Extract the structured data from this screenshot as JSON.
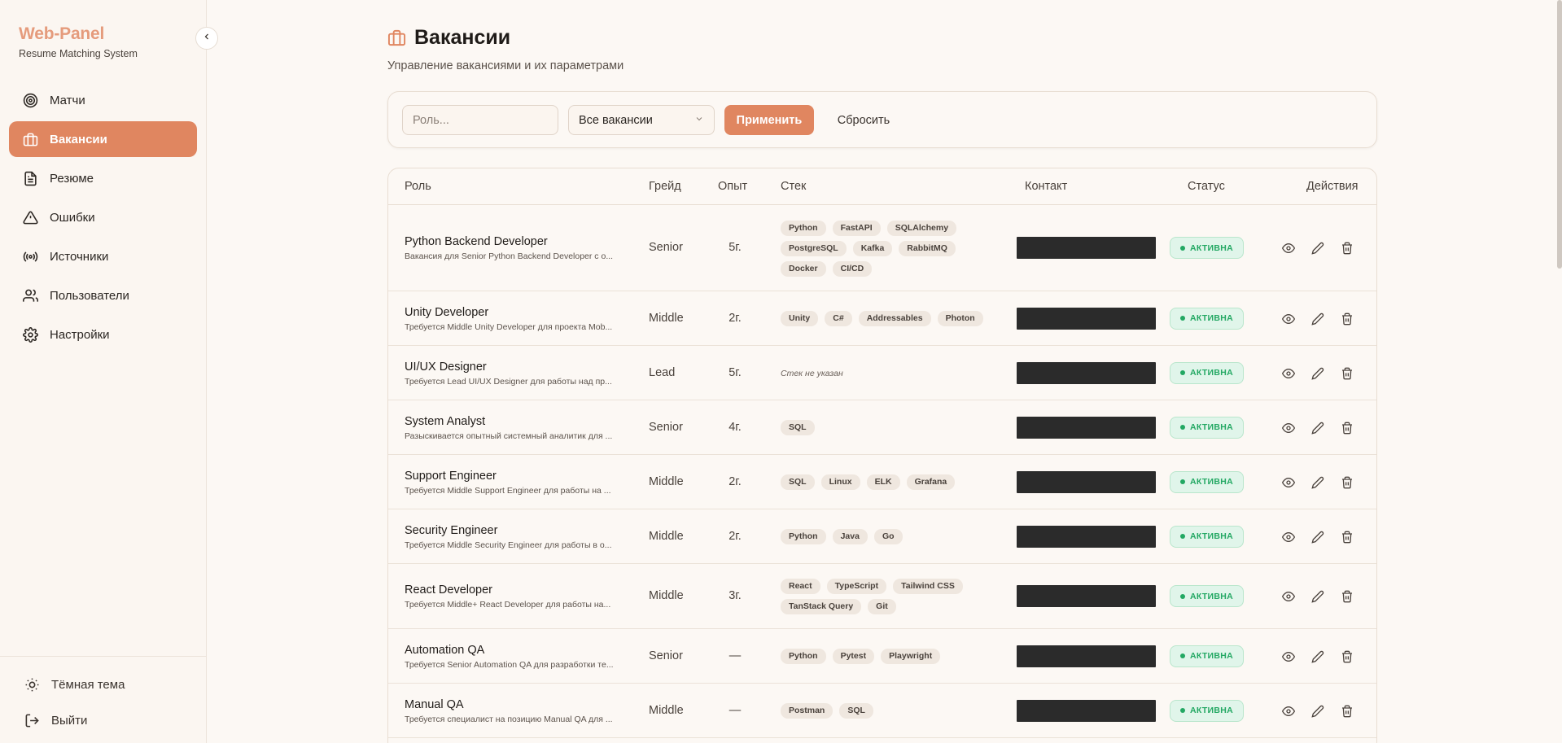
{
  "sidebar": {
    "brand_title": "Web-Panel",
    "brand_sub": "Resume Matching System",
    "items": [
      {
        "label": "Матчи",
        "icon": "target-icon",
        "active": false
      },
      {
        "label": "Вакансии",
        "icon": "briefcase-icon",
        "active": true
      },
      {
        "label": "Резюме",
        "icon": "document-icon",
        "active": false
      },
      {
        "label": "Ошибки",
        "icon": "warning-icon",
        "active": false
      },
      {
        "label": "Источники",
        "icon": "broadcast-icon",
        "active": false
      },
      {
        "label": "Пользователи",
        "icon": "users-icon",
        "active": false
      },
      {
        "label": "Настройки",
        "icon": "gear-icon",
        "active": false
      }
    ],
    "theme_label": "Тёмная тема",
    "logout_label": "Выйти"
  },
  "header": {
    "title": "Вакансии",
    "subtitle": "Управление вакансиями и их параметрами"
  },
  "filters": {
    "role_placeholder": "Роль...",
    "select_value": "Все вакансии",
    "apply_label": "Применить",
    "reset_label": "Сбросить"
  },
  "table": {
    "columns": [
      "Роль",
      "Грейд",
      "Опыт",
      "Стек",
      "Контакт",
      "Статус",
      "Действия"
    ],
    "empty_stack_label": "Стек не указан",
    "rows": [
      {
        "title": "Python Backend Developer",
        "desc": "Вакансия для Senior Python Backend Developer с о...",
        "grade": "Senior",
        "exp": "5г.",
        "stack": [
          "Python",
          "FastAPI",
          "SQLAlchemy",
          "PostgreSQL",
          "Kafka",
          "RabbitMQ",
          "Docker",
          "CI/CD"
        ],
        "status": "АКТИВНА"
      },
      {
        "title": "Unity Developer",
        "desc": "Требуется Middle Unity Developer для проекта Mob...",
        "grade": "Middle",
        "exp": "2г.",
        "stack": [
          "Unity",
          "C#",
          "Addressables",
          "Photon"
        ],
        "status": "АКТИВНА"
      },
      {
        "title": "UI/UX Designer",
        "desc": "Требуется Lead UI/UX Designer для работы над пр...",
        "grade": "Lead",
        "exp": "5г.",
        "stack": [],
        "status": "АКТИВНА"
      },
      {
        "title": "System Analyst",
        "desc": "Разыскивается опытный системный аналитик для ...",
        "grade": "Senior",
        "exp": "4г.",
        "stack": [
          "SQL"
        ],
        "status": "АКТИВНА"
      },
      {
        "title": "Support Engineer",
        "desc": "Требуется Middle Support Engineer для работы на ...",
        "grade": "Middle",
        "exp": "2г.",
        "stack": [
          "SQL",
          "Linux",
          "ELK",
          "Grafana"
        ],
        "status": "АКТИВНА"
      },
      {
        "title": "Security Engineer",
        "desc": "Требуется Middle Security Engineer для работы в о...",
        "grade": "Middle",
        "exp": "2г.",
        "stack": [
          "Python",
          "Java",
          "Go"
        ],
        "status": "АКТИВНА"
      },
      {
        "title": "React Developer",
        "desc": "Требуется Middle+ React Developer для работы на...",
        "grade": "Middle",
        "exp": "3г.",
        "stack": [
          "React",
          "TypeScript",
          "Tailwind CSS",
          "TanStack Query",
          "Git"
        ],
        "status": "АКТИВНА"
      },
      {
        "title": "Automation QA",
        "desc": "Требуется Senior Automation QA для разработки те...",
        "grade": "Senior",
        "exp": "—",
        "stack": [
          "Python",
          "Pytest",
          "Playwright"
        ],
        "status": "АКТИВНА"
      },
      {
        "title": "Manual QA",
        "desc": "Требуется специалист на позицию Manual QA для ...",
        "grade": "Middle",
        "exp": "—",
        "stack": [
          "Postman",
          "SQL"
        ],
        "status": "АКТИВНА"
      }
    ]
  },
  "colors": {
    "accent": "#e08660",
    "brand": "#e59b7c",
    "status_active": "#23a863"
  }
}
